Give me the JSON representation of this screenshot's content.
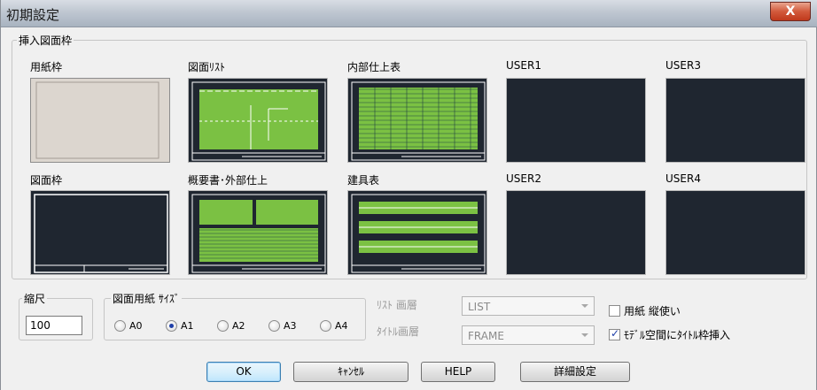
{
  "window": {
    "title": "初期設定",
    "close_label": "X"
  },
  "insert_frame_group": {
    "legend": "挿入図面枠"
  },
  "frames": [
    {
      "label": "用紙枠",
      "kind": "paper"
    },
    {
      "label": "図面ﾘｽﾄ",
      "kind": "list"
    },
    {
      "label": "内部仕上表",
      "kind": "table"
    },
    {
      "label": "USER1",
      "kind": "empty"
    },
    {
      "label": "USER3",
      "kind": "empty"
    },
    {
      "label": "図面枠",
      "kind": "frame"
    },
    {
      "label": "概要書･外部仕上",
      "kind": "outline"
    },
    {
      "label": "建具表",
      "kind": "fittings"
    },
    {
      "label": "USER2",
      "kind": "empty"
    },
    {
      "label": "USER4",
      "kind": "empty"
    }
  ],
  "scale": {
    "legend": "縮尺",
    "value": "100"
  },
  "paper_size": {
    "legend": "図面用紙 ｻｲｽﾞ",
    "options": [
      "A0",
      "A1",
      "A2",
      "A3",
      "A4"
    ],
    "selected": "A1"
  },
  "layers": {
    "list_label": "ﾘｽﾄ 画層",
    "list_value": "LIST",
    "title_label": "ﾀｲﾄﾙ画層",
    "title_value": "FRAME"
  },
  "options": {
    "portrait_label": "用紙 縦使い",
    "portrait_checked": false,
    "model_space_label": "ﾓﾃﾞﾙ空間にﾀｲﾄﾙ枠挿入",
    "model_space_checked": true
  },
  "buttons": {
    "ok": "OK",
    "cancel": "ｷｬﾝｾﾙ",
    "help": "HELP",
    "detail": "詳細設定"
  },
  "colors": {
    "thumb_bg": "#1f2630",
    "green": "#7bc143",
    "paper": "#dcd6cf"
  }
}
